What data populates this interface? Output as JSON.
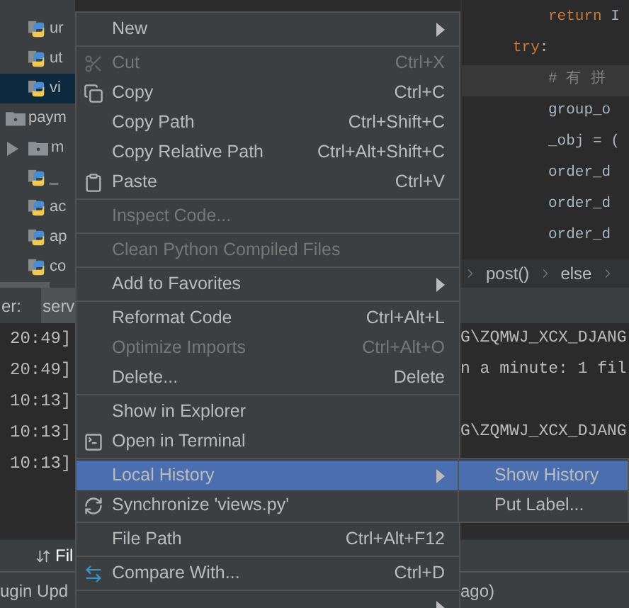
{
  "project_tree": [
    {
      "children": [
        {
          "label": "ur",
          "kind": "python",
          "selected": false
        },
        {
          "label": "ut",
          "kind": "python",
          "selected": false
        },
        {
          "label": "vi",
          "kind": "python",
          "selected": true
        }
      ]
    },
    {
      "label": "paym",
      "kind": "folder",
      "selected": false,
      "children": [
        {
          "label": "m",
          "kind": "folder",
          "selected": false,
          "expanded": false
        },
        {
          "label": "_",
          "kind": "python",
          "selected": false
        },
        {
          "label": "ac",
          "kind": "python",
          "selected": false
        },
        {
          "label": "ap",
          "kind": "python",
          "selected": false
        },
        {
          "label": "co",
          "kind": "python",
          "selected": false
        }
      ]
    }
  ],
  "editor": {
    "lines": [
      {
        "indented": true,
        "segments": [
          {
            "text": "return",
            "kind": "keyword"
          },
          {
            "text": " I",
            "kind": "plain"
          }
        ],
        "current": false
      },
      {
        "indented": false,
        "segments": [
          {
            "text": "try",
            "kind": "keyword"
          },
          {
            "text": ":",
            "kind": "plain"
          }
        ],
        "current": false
      },
      {
        "indented": true,
        "segments": [
          {
            "text": "# 有 拼",
            "kind": "comment"
          }
        ],
        "current": true
      },
      {
        "indented": true,
        "segments": [
          {
            "text": "group_o",
            "kind": "plain"
          }
        ],
        "current": false
      },
      {
        "indented": true,
        "segments": [
          {
            "text": "_obj = (",
            "kind": "plain"
          }
        ],
        "current": false
      },
      {
        "indented": true,
        "segments": [
          {
            "text": "order_d",
            "kind": "plain"
          }
        ],
        "current": false
      },
      {
        "indented": true,
        "segments": [
          {
            "text": "order_d",
            "kind": "plain"
          }
        ],
        "current": false
      },
      {
        "indented": true,
        "segments": [
          {
            "text": "order_d",
            "kind": "plain"
          }
        ],
        "current": false
      }
    ]
  },
  "breadcrumbs": [
    "post()",
    "else"
  ],
  "run_panel": {
    "tabs": [
      {
        "label": "er:",
        "selected": false
      },
      {
        "label": "serv",
        "selected": true
      }
    ],
    "left_lines": [
      "20:49]",
      "20:49]",
      "10:13]",
      "10:13]",
      "10:13]"
    ],
    "right_lines": [
      {
        "kind": "text",
        "text": "G\\ZQMWJ_XCX_DJANG"
      },
      {
        "kind": "text",
        "text": "n a minute: 1 fil"
      },
      {
        "kind": "blank"
      },
      {
        "kind": "text",
        "text": "G\\ZQMWJ_XCX_DJANG"
      }
    ]
  },
  "tool_tab": "Fil",
  "status_bar": {
    "left": "ugin Upd",
    "right": "ago)"
  },
  "context_menu": [
    {
      "kind": "item",
      "label": "New",
      "submenu": true,
      "disabled": false,
      "selected": false
    },
    {
      "kind": "separator"
    },
    {
      "kind": "item",
      "label": "Cut",
      "shortcut": "Ctrl+X",
      "disabled": true,
      "selected": false
    },
    {
      "kind": "item",
      "label": "Copy",
      "shortcut": "Ctrl+C",
      "disabled": false,
      "selected": false
    },
    {
      "kind": "item",
      "label": "Copy Path",
      "shortcut": "Ctrl+Shift+C",
      "disabled": false,
      "selected": false
    },
    {
      "kind": "item",
      "label": "Copy Relative Path",
      "shortcut": "Ctrl+Alt+Shift+C",
      "disabled": false,
      "selected": false
    },
    {
      "kind": "item",
      "label": "Paste",
      "shortcut": "Ctrl+V",
      "disabled": false,
      "selected": false
    },
    {
      "kind": "separator"
    },
    {
      "kind": "item",
      "label": "Inspect Code...",
      "disabled": true,
      "selected": false
    },
    {
      "kind": "separator"
    },
    {
      "kind": "item",
      "label": "Clean Python Compiled Files",
      "disabled": true,
      "selected": false
    },
    {
      "kind": "separator"
    },
    {
      "kind": "item",
      "label": "Add to Favorites",
      "submenu": true,
      "disabled": false,
      "selected": false
    },
    {
      "kind": "separator"
    },
    {
      "kind": "item",
      "label": "Reformat Code",
      "shortcut": "Ctrl+Alt+L",
      "disabled": false,
      "selected": false
    },
    {
      "kind": "item",
      "label": "Optimize Imports",
      "shortcut": "Ctrl+Alt+O",
      "disabled": true,
      "selected": false
    },
    {
      "kind": "item",
      "label": "Delete...",
      "shortcut": "Delete",
      "disabled": false,
      "selected": false
    },
    {
      "kind": "separator"
    },
    {
      "kind": "item",
      "label": "Show in Explorer",
      "disabled": false,
      "selected": false
    },
    {
      "kind": "item",
      "label": "Open in Terminal",
      "disabled": false,
      "selected": false
    },
    {
      "kind": "separator"
    },
    {
      "kind": "item",
      "label": "Local History",
      "submenu": true,
      "disabled": false,
      "selected": true
    },
    {
      "kind": "item",
      "label": "Synchronize 'views.py'",
      "disabled": false,
      "selected": false
    },
    {
      "kind": "separator"
    },
    {
      "kind": "item",
      "label": "File Path",
      "shortcut": "Ctrl+Alt+F12",
      "disabled": false,
      "selected": false
    },
    {
      "kind": "separator"
    },
    {
      "kind": "item",
      "label": "Compare With...",
      "shortcut": "Ctrl+D",
      "disabled": false,
      "selected": false
    },
    {
      "kind": "separator"
    },
    {
      "kind": "item",
      "submenu": true,
      "disabled": false,
      "selected": false
    }
  ],
  "submenu": [
    {
      "label": "Show History",
      "selected": true
    },
    {
      "label": "Put Label...",
      "selected": false
    }
  ]
}
